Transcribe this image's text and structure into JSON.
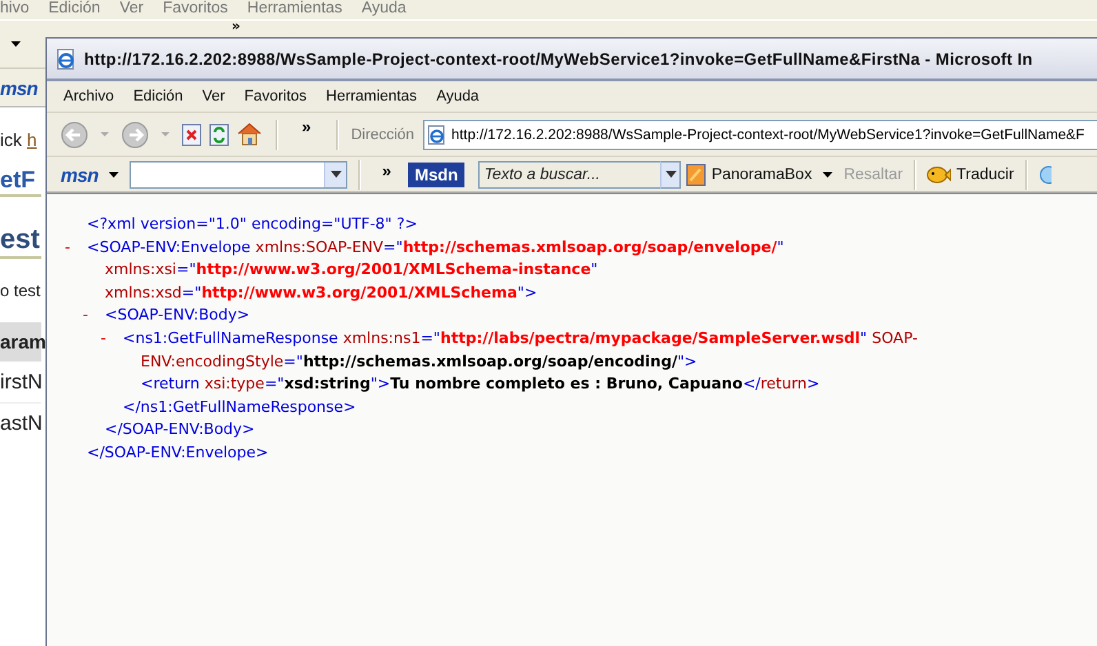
{
  "background_window": {
    "menu": [
      "hivo",
      "Edición",
      "Ver",
      "Favoritos",
      "Herramientas",
      "Ayuda"
    ],
    "toolbar_chevron": "»",
    "logo": "msn",
    "page": {
      "intro": "ick ",
      "intro_link": "h",
      "heading_1": "etF",
      "heading_2": "est",
      "paragraph": "o test",
      "table_header": "aram",
      "table_rows": [
        "irstN",
        "astN"
      ]
    }
  },
  "window": {
    "title": "http://172.16.2.202:8988/WsSample-Project-context-root/MyWebService1?invoke=GetFullName&FirstNa - Microsoft In",
    "menu": [
      "Archivo",
      "Edición",
      "Ver",
      "Favoritos",
      "Herramientas",
      "Ayuda"
    ],
    "toolbar": {
      "chevron": "»",
      "address_label": "Dirección",
      "address": "http://172.16.2.202:8988/WsSample-Project-context-root/MyWebService1?invoke=GetFullName&F"
    },
    "msn_toolbar": {
      "logo": "msn",
      "chevron": "»",
      "msdn": "Msdn",
      "search_placeholder": "Texto a buscar...",
      "panorama": "PanoramaBox",
      "highlight": {
        "label": "Resaltar",
        "disabled": true
      },
      "translate": "Traducir"
    },
    "xml": [
      {
        "open_lines": [
          [
            {
              "kind": "tag",
              "text": "<?xml version=\"1.0\" encoding=\"UTF-8\" ?>"
            }
          ]
        ]
      },
      {
        "toggle": "-",
        "open_lines": [
          [
            {
              "kind": "tag",
              "text": "<SOAP-ENV:Envelope"
            },
            {
              "kind": "attr",
              "text": " xmlns:SOAP-ENV"
            },
            {
              "kind": "punct",
              "text": "=\""
            },
            {
              "kind": "value",
              "text": "http://schemas.xmlsoap.org/soap/envelope/"
            },
            {
              "kind": "punct",
              "text": "\""
            }
          ],
          [
            {
              "kind": "attr",
              "text": "xmlns:xsi"
            },
            {
              "kind": "punct",
              "text": "=\""
            },
            {
              "kind": "value",
              "text": "http://www.w3.org/2001/XMLSchema-instance"
            },
            {
              "kind": "punct",
              "text": "\""
            }
          ],
          [
            {
              "kind": "attr",
              "text": "xmlns:xsd"
            },
            {
              "kind": "punct",
              "text": "=\""
            },
            {
              "kind": "value",
              "text": "http://www.w3.org/2001/XMLSchema"
            },
            {
              "kind": "punct",
              "text": "\">"
            }
          ]
        ],
        "children": [
          {
            "toggle": "-",
            "open_lines": [
              [
                {
                  "kind": "tag",
                  "text": "<SOAP-ENV:Body>"
                }
              ]
            ],
            "children": [
              {
                "toggle": "-",
                "open_lines": [
                  [
                    {
                      "kind": "tag",
                      "text": "<ns1:GetFullNameResponse"
                    },
                    {
                      "kind": "attr",
                      "text": " xmlns:ns1"
                    },
                    {
                      "kind": "punct",
                      "text": "=\""
                    },
                    {
                      "kind": "value",
                      "text": "http://labs/pectra/mypackage/SampleServer.wsdl"
                    },
                    {
                      "kind": "punct",
                      "text": "\""
                    },
                    {
                      "kind": "attr",
                      "text": " SOAP-"
                    }
                  ],
                  [
                    {
                      "kind": "attr",
                      "text": "ENV:encodingStyle"
                    },
                    {
                      "kind": "punct",
                      "text": "=\""
                    },
                    {
                      "kind": "text",
                      "text": "http://schemas.xmlsoap.org/soap/encoding/"
                    },
                    {
                      "kind": "punct",
                      "text": "\">"
                    }
                  ]
                ],
                "children": [
                  {
                    "open_lines": [
                      [
                        {
                          "kind": "tag",
                          "text": "<return"
                        },
                        {
                          "kind": "attr",
                          "text": " xsi:type"
                        },
                        {
                          "kind": "punct",
                          "text": "=\""
                        },
                        {
                          "kind": "text",
                          "text": "xsd:string"
                        },
                        {
                          "kind": "punct",
                          "text": "\">"
                        },
                        {
                          "kind": "text",
                          "text": "Tu nombre completo es : Bruno, Capuano"
                        },
                        {
                          "kind": "punct",
                          "text": "</"
                        },
                        {
                          "kind": "attr",
                          "text": "return"
                        },
                        {
                          "kind": "punct",
                          "text": ">"
                        }
                      ]
                    ]
                  }
                ],
                "close": [
                  {
                    "kind": "tag",
                    "text": "</ns1:GetFullNameResponse>"
                  }
                ]
              }
            ],
            "close": [
              {
                "kind": "tag",
                "text": "</SOAP-ENV:Body>"
              }
            ]
          }
        ],
        "close": [
          {
            "kind": "tag",
            "text": "</SOAP-ENV:Envelope>"
          }
        ]
      }
    ]
  }
}
